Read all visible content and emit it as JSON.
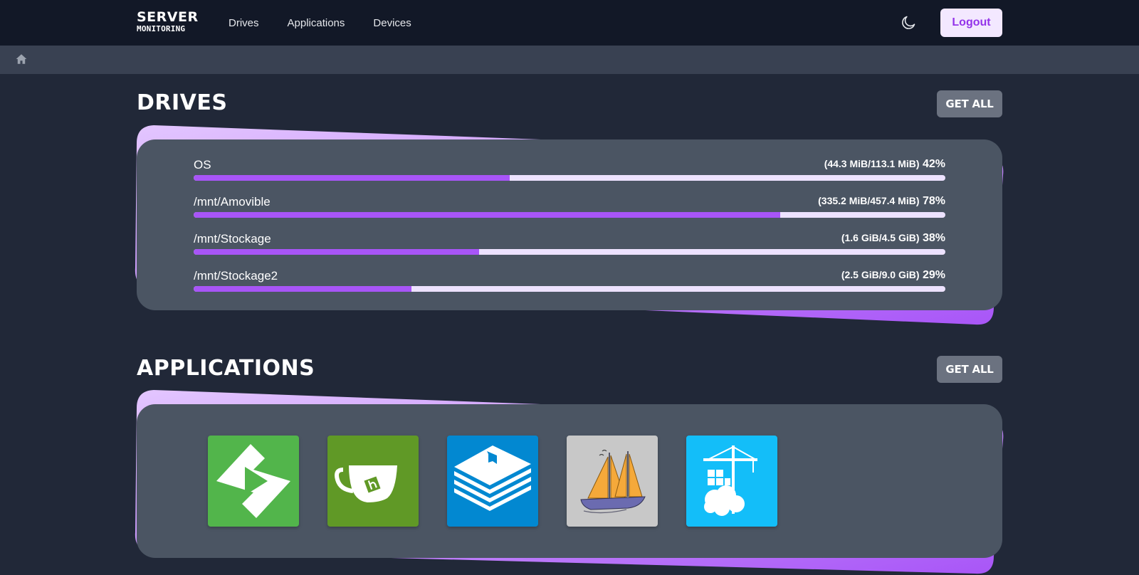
{
  "brand": {
    "line1": "SERVER",
    "line2": "MONITORING"
  },
  "nav": {
    "links": [
      "Drives",
      "Applications",
      "Devices"
    ],
    "logout": "Logout"
  },
  "theme_toggle_icon": "moon-icon",
  "breadcrumb_icon": "home-icon",
  "drives": {
    "title": "DRIVES",
    "get_all": "GET ALL",
    "items": [
      {
        "name": "OS",
        "size": "(44.3 MiB/113.1 MiB)",
        "percent": "42%",
        "fill": 0.42
      },
      {
        "name": "/mnt/Amovible",
        "size": "(335.2 MiB/457.4 MiB)",
        "percent": "78%",
        "fill": 0.78
      },
      {
        "name": "/mnt/Stockage",
        "size": "(1.6 GiB/4.5 GiB)",
        "percent": "38%",
        "fill": 0.38
      },
      {
        "name": "/mnt/Stockage2",
        "size": "(2.5 GiB/9.0 GiB)",
        "percent": "29%",
        "fill": 0.29
      }
    ]
  },
  "applications": {
    "title": "APPLICATIONS",
    "get_all": "GET ALL",
    "items": [
      {
        "icon": "emby-icon",
        "color": "#52b54b"
      },
      {
        "icon": "gitea-icon",
        "color": "#609926"
      },
      {
        "icon": "bookstack-icon",
        "color": "#0288d1"
      },
      {
        "icon": "sailboat-icon",
        "color": "#c8c8c8"
      },
      {
        "icon": "portainer-icon",
        "color": "#13bef9"
      }
    ]
  },
  "colors": {
    "accent": "#a855f7",
    "accent_light": "#ede2ff",
    "card": "#4b5563",
    "navbar": "#121827",
    "background": "#212838"
  }
}
